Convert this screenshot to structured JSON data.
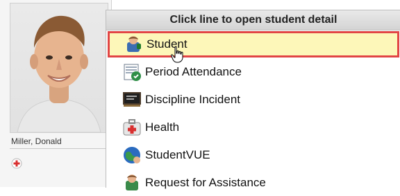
{
  "student": {
    "name": "Miller, Donald",
    "photo_icon": "student-photo",
    "add_icon": "red-plus-icon"
  },
  "menu": {
    "header": "Click line to open student detail",
    "items": [
      {
        "label": "Student",
        "icon": "student-icon",
        "selected": true
      },
      {
        "label": "Period Attendance",
        "icon": "attendance-icon"
      },
      {
        "label": "Discipline Incident",
        "icon": "discipline-icon"
      },
      {
        "label": "Health",
        "icon": "health-icon"
      },
      {
        "label": "StudentVUE",
        "icon": "studentvue-icon"
      },
      {
        "label": "Request for Assistance",
        "icon": "assistance-icon"
      }
    ]
  },
  "colors": {
    "selected_bg": "#fdf7b9",
    "selected_border": "#e14545"
  }
}
